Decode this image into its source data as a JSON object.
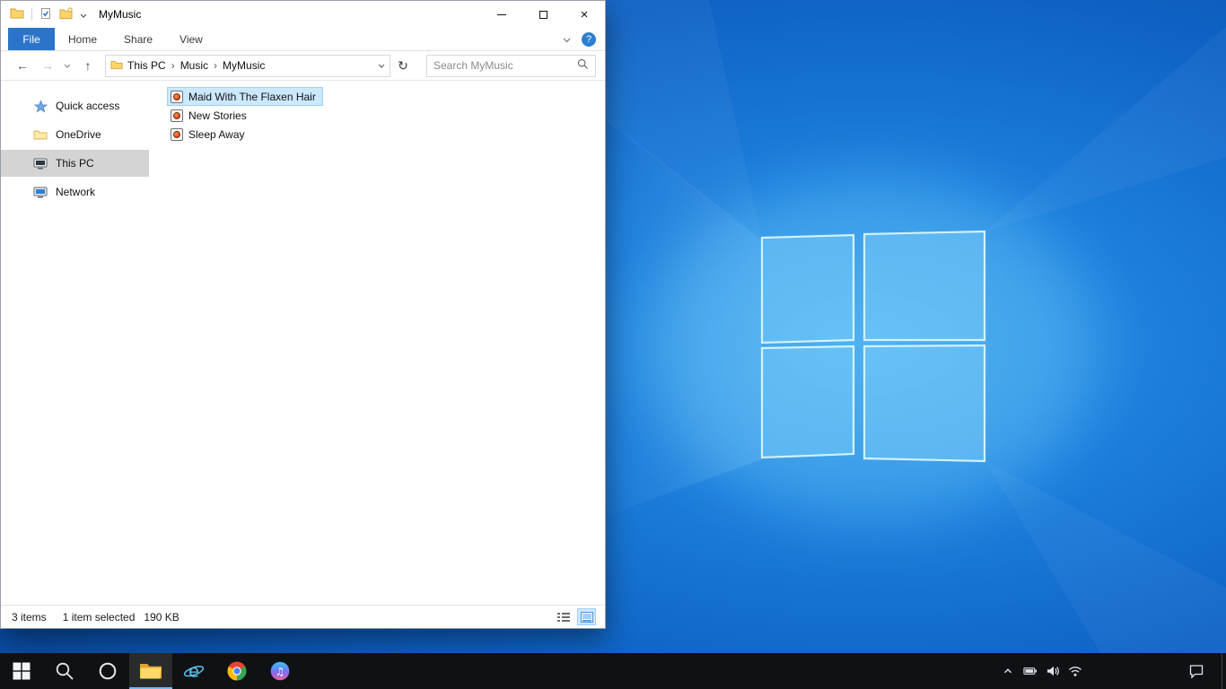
{
  "window": {
    "titlebar": {
      "title": "MyMusic"
    },
    "caption": {
      "close_glyph": "×"
    },
    "ribbon": {
      "file_tab": "File",
      "tabs": [
        "Home",
        "Share",
        "View"
      ],
      "help_label": "?"
    },
    "addressbar": {
      "icons": {
        "back": "←",
        "forward": "→",
        "up": "↑",
        "refresh": "↻",
        "crumb_separator": "›"
      },
      "crumbs": [
        "This PC",
        "Music",
        "MyMusic"
      ],
      "search_placeholder": "Search MyMusic"
    },
    "sidebar": {
      "items": [
        {
          "label": "Quick access",
          "icon": "star-icon",
          "selected": false
        },
        {
          "label": "OneDrive",
          "icon": "folder-icon",
          "selected": false
        },
        {
          "label": "This PC",
          "icon": "computer-icon",
          "selected": true
        },
        {
          "label": "Network",
          "icon": "network-icon",
          "selected": false
        }
      ]
    },
    "files": [
      {
        "name": "Maid With The Flaxen Hair",
        "icon": "audio-file-icon",
        "selected": true
      },
      {
        "name": "New Stories",
        "icon": "audio-file-icon",
        "selected": false
      },
      {
        "name": "Sleep Away",
        "icon": "audio-file-icon",
        "selected": false
      }
    ],
    "statusbar": {
      "count": "3 items",
      "selected": "1 item selected",
      "size": "190 KB"
    }
  },
  "taskbar": {
    "buttons": [
      "start",
      "search",
      "cortana",
      "file-explorer",
      "internet-explorer",
      "chrome",
      "itunes"
    ],
    "active_button": "file-explorer",
    "tray_icons": [
      "chevron-up",
      "battery",
      "speaker",
      "wifi"
    ],
    "action_center": "action-center"
  },
  "colors": {
    "accent_blue": "#0078d7",
    "file_tab_blue": "#2b74c9",
    "selection_bg": "#cce8ff",
    "selection_border": "#99d1ff",
    "nav_selected_bg": "#d4d4d4",
    "taskbar_bg": "#101114"
  }
}
